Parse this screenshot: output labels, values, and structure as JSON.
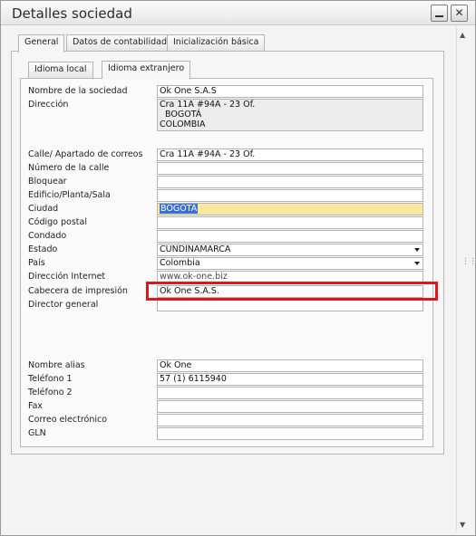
{
  "window": {
    "title": "Detalles sociedad"
  },
  "tabs": [
    {
      "label": "General",
      "active": true
    },
    {
      "label": "Datos de contabilidad",
      "active": false
    },
    {
      "label": "Inicialización básica",
      "active": false
    }
  ],
  "subtabs": [
    {
      "label": "Idioma local",
      "active": false
    },
    {
      "label": "Idioma extranjero",
      "active": true
    }
  ],
  "fields": {
    "nombre_sociedad": {
      "label": "Nombre de la sociedad",
      "value": "Ok One S.A.S"
    },
    "direccion": {
      "label": "Dirección",
      "value": "Cra 11A #94A - 23 Of.\n  BOGOTÁ\nCOLOMBIA"
    },
    "calle": {
      "label": "Calle/ Apartado de correos",
      "value": "Cra 11A #94A - 23 Of."
    },
    "numero_calle": {
      "label": "Número de la calle",
      "value": ""
    },
    "bloquear": {
      "label": "Bloquear",
      "value": ""
    },
    "edificio": {
      "label": "Edificio/Planta/Sala",
      "value": ""
    },
    "ciudad": {
      "label": "Ciudad",
      "value": "BOGOTÁ"
    },
    "codigo_postal": {
      "label": "Código postal",
      "value": ""
    },
    "condado": {
      "label": "Condado",
      "value": ""
    },
    "estado": {
      "label": "Estado",
      "value": "CUNDINAMARCA"
    },
    "pais": {
      "label": "País",
      "value": "Colombia"
    },
    "direccion_internet": {
      "label": "Dirección Internet",
      "value": "www.ok-one.biz"
    },
    "cabecera": {
      "label": "Cabecera de impresión",
      "value": "Ok One S.A.S."
    },
    "director": {
      "label": "Director general",
      "value": ""
    },
    "nombre_alias": {
      "label": "Nombre alias",
      "value": "Ok One"
    },
    "telefono1": {
      "label": "Teléfono 1",
      "value": "57 (1) 6115940"
    },
    "telefono2": {
      "label": "Teléfono 2",
      "value": ""
    },
    "fax": {
      "label": "Fax",
      "value": ""
    },
    "correo": {
      "label": "Correo electrónico",
      "value": ""
    },
    "gln": {
      "label": "GLN",
      "value": ""
    }
  },
  "colors": {
    "highlight_border": "#e0161c",
    "selected_field": "#fbe8a0",
    "selection": "#3a6fd8"
  },
  "icons": {
    "minimize": "minimize-icon",
    "close": "close-icon"
  }
}
